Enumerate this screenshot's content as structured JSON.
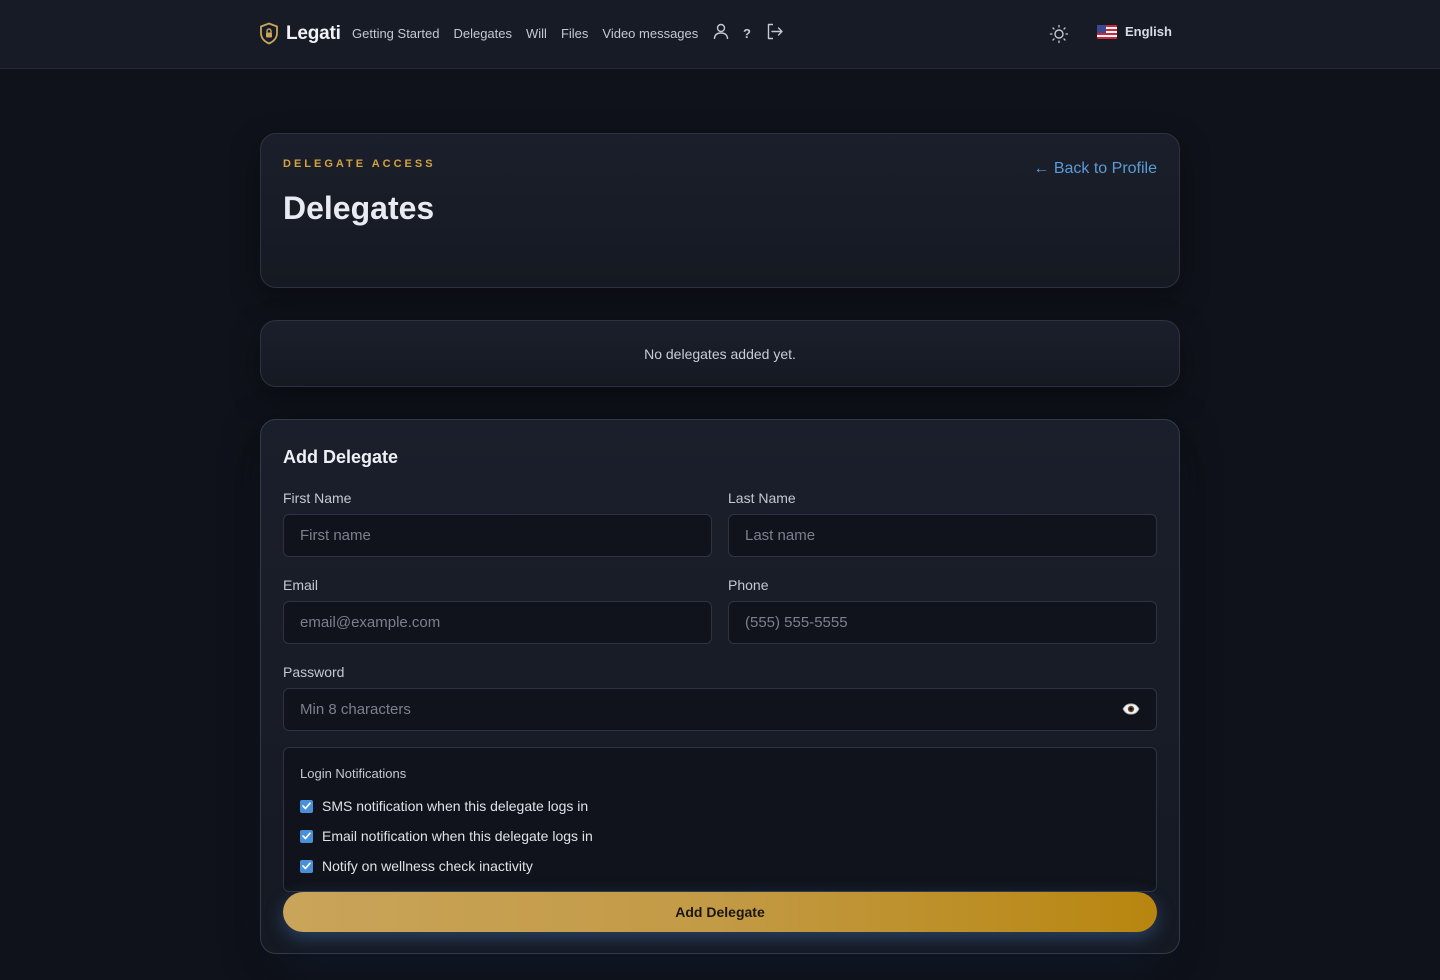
{
  "nav": {
    "brand": "Legati",
    "links": [
      "Getting Started",
      "Delegates",
      "Will",
      "Files",
      "Video messages"
    ],
    "help_label": "?",
    "language": "English",
    "icons": {
      "brand": "shield-lock-icon",
      "profile": "user-icon",
      "logout": "logout-icon",
      "theme": "sun-icon",
      "flag": "us-flag-icon"
    }
  },
  "header": {
    "eyebrow": "DELEGATE ACCESS",
    "title": "Delegates",
    "back_link": "← Back to Profile"
  },
  "delegates": {
    "empty_message": "No delegates added yet."
  },
  "form": {
    "title": "Add Delegate",
    "first_name": {
      "label": "First Name",
      "placeholder": "First name",
      "value": ""
    },
    "last_name": {
      "label": "Last Name",
      "placeholder": "Last name",
      "value": ""
    },
    "email": {
      "label": "Email",
      "placeholder": "email@example.com",
      "value": ""
    },
    "phone": {
      "label": "Phone",
      "placeholder": "(555) 555-5555",
      "value": ""
    },
    "password": {
      "label": "Password",
      "placeholder": "Min 8 characters",
      "value": "",
      "toggle_icon": "eye-icon"
    },
    "notifications": {
      "title": "Login Notifications",
      "options": [
        {
          "label": "SMS notification when this delegate logs in",
          "checked": true
        },
        {
          "label": "Email notification when this delegate logs in",
          "checked": true
        },
        {
          "label": "Notify on wellness check inactivity",
          "checked": true
        }
      ]
    },
    "submit_label": "Add Delegate"
  },
  "colors": {
    "accent_gold": "#d4a23f",
    "link_blue": "#5b9bd8",
    "checkbox_blue": "#4a90d9",
    "background": "#0f121a"
  }
}
